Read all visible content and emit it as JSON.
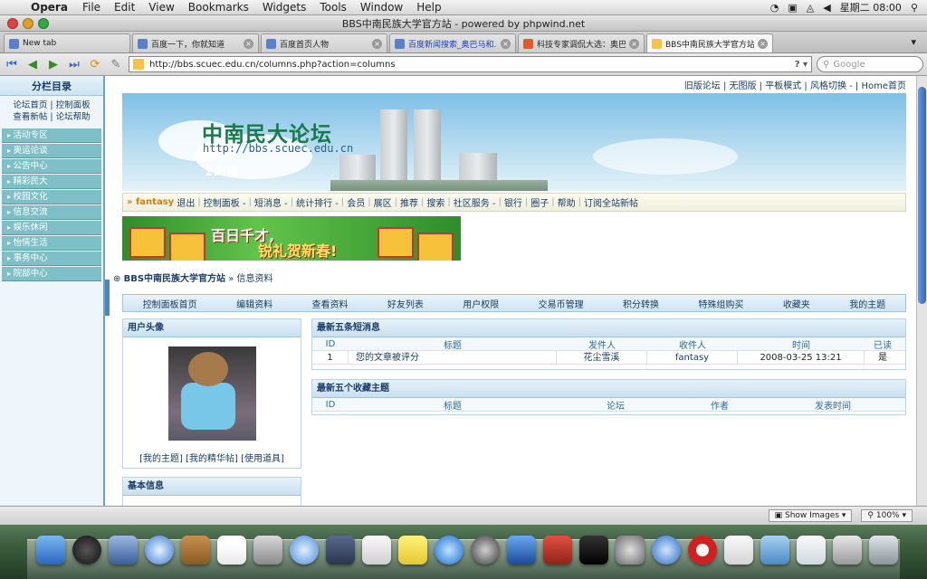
{
  "menubar": {
    "app_name": "Opera",
    "items": [
      "File",
      "Edit",
      "View",
      "Bookmarks",
      "Widgets",
      "Tools",
      "Window",
      "Help"
    ],
    "clock": "星期二 08:00"
  },
  "window": {
    "title": "BBS中南民族大学官方站 - powered by phpwind.net"
  },
  "tabs": [
    {
      "label": "New tab"
    },
    {
      "label": "百度一下，你就知道"
    },
    {
      "label": "百度首页人物"
    },
    {
      "label": "百度新闻搜索_奥巴马和..."
    },
    {
      "label": "科技专家调侃大选：奥巴..."
    },
    {
      "label": "BBS中南民族大学官方站 ..."
    }
  ],
  "address": {
    "url": "http://bbs.scuec.edu.cn/columns.php?action=columns",
    "search_placeholder": "Google"
  },
  "sidebar": {
    "title": "分栏目录",
    "link_row1": "论坛首页 | 控制面板",
    "link_row2": "查看新帖 | 论坛帮助",
    "items": [
      "活动专区",
      "奥运论谈",
      "公告中心",
      "精彩民大",
      "校园文化",
      "信息交流",
      "娱乐休闲",
      "怡情生活",
      "事务中心",
      "院部中心"
    ]
  },
  "toplinks": "旧版论坛 | 无图版 | 平板模式 | 风格切换 - | Home首页",
  "banner": {
    "logo_text": "中南民大论坛",
    "logo_url": "http://bbs.scuec.edu.cn",
    "year": "2008"
  },
  "navbar": {
    "user": "» fantasy",
    "items": [
      "退出",
      "控制面板 -",
      "短消息 -",
      "统计排行 -",
      "会员",
      "展区",
      "推荐",
      "搜索",
      "社区服务 -",
      "银行",
      "圈子",
      "帮助",
      "订阅全站新帖"
    ]
  },
  "ad": {
    "slogan1": "百日千才,",
    "slogan2": "锐礼贺新春!"
  },
  "breadcrumb": {
    "site": "BBS中南民族大学官方站",
    "current": "» 信息资料"
  },
  "tabs_bar": [
    "控制面板首页",
    "编辑资料",
    "查看资料",
    "好友列表",
    "用户权限",
    "交易币管理",
    "积分转换",
    "特殊组购买",
    "收藏夹",
    "我的主题"
  ],
  "avatar_panel": {
    "title": "用户头像",
    "links": "[我的主题] [我的精华帖] [使用道具]"
  },
  "basic_panel": {
    "title": "基本信息"
  },
  "messages": {
    "title": "最新五条短消息",
    "columns": [
      "ID",
      "标题",
      "发件人",
      "收件人",
      "时间",
      "已读"
    ],
    "rows": [
      {
        "id": "1",
        "title": "您的文章被评分",
        "sender": "花尘雪溪",
        "recipient": "fantasy",
        "time": "2008-03-25 13:21",
        "read": "是"
      }
    ]
  },
  "favorites": {
    "title": "最新五个收藏主题",
    "columns": [
      "ID",
      "标题",
      "论坛",
      "作者",
      "发表时间"
    ]
  },
  "statusbar": {
    "show_images": "Show Images",
    "zoom": "100%"
  },
  "colors": {
    "sidebar_item": "#7fbfc7",
    "link": "#1a3c66",
    "accent_user": "#e07b00"
  }
}
